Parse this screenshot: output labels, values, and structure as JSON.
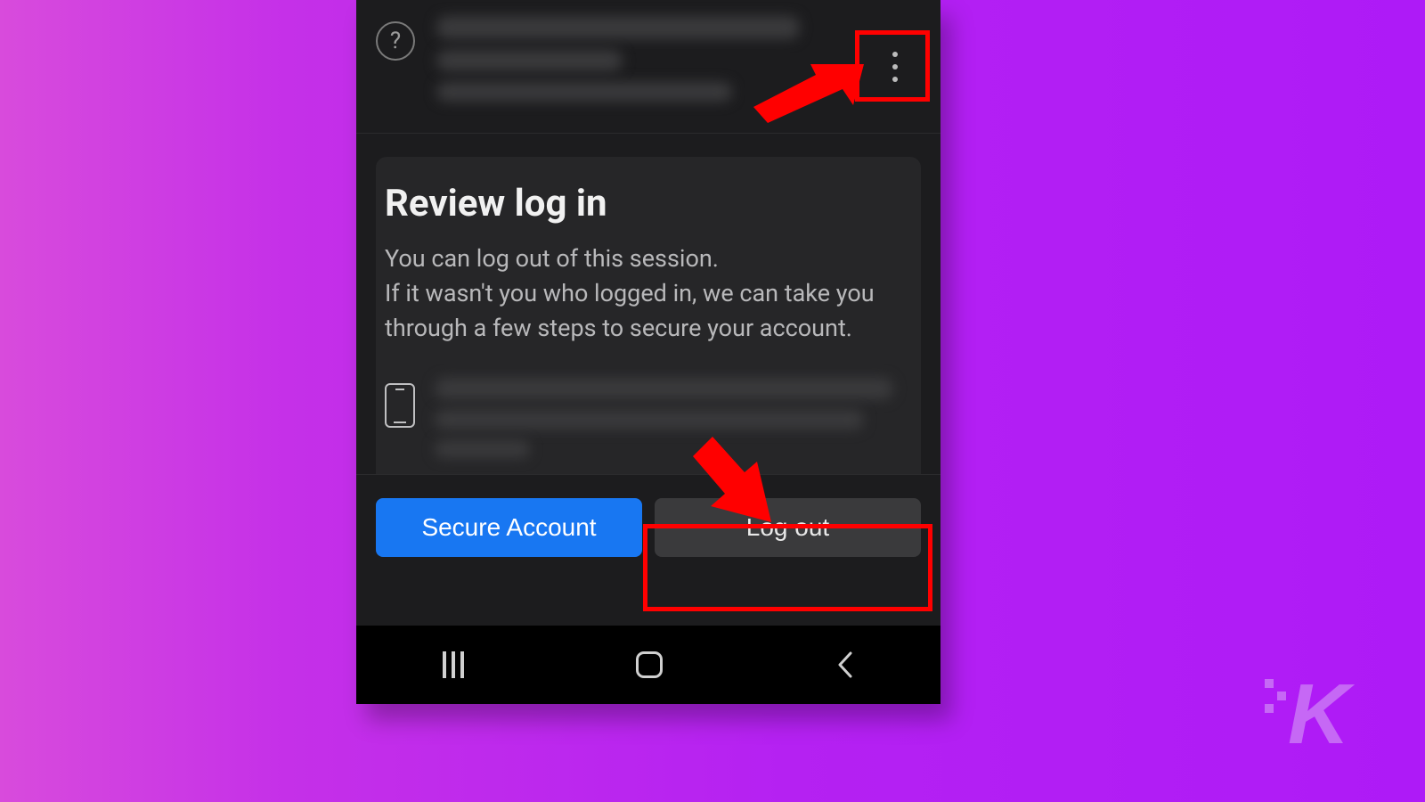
{
  "review": {
    "title": "Review log in",
    "desc": "You can log out of this session.\nIf it wasn't you who logged in, we can take you through a few steps to secure your account."
  },
  "buttons": {
    "secure": "Secure Account",
    "logout": "Log out"
  },
  "watermark": "K"
}
